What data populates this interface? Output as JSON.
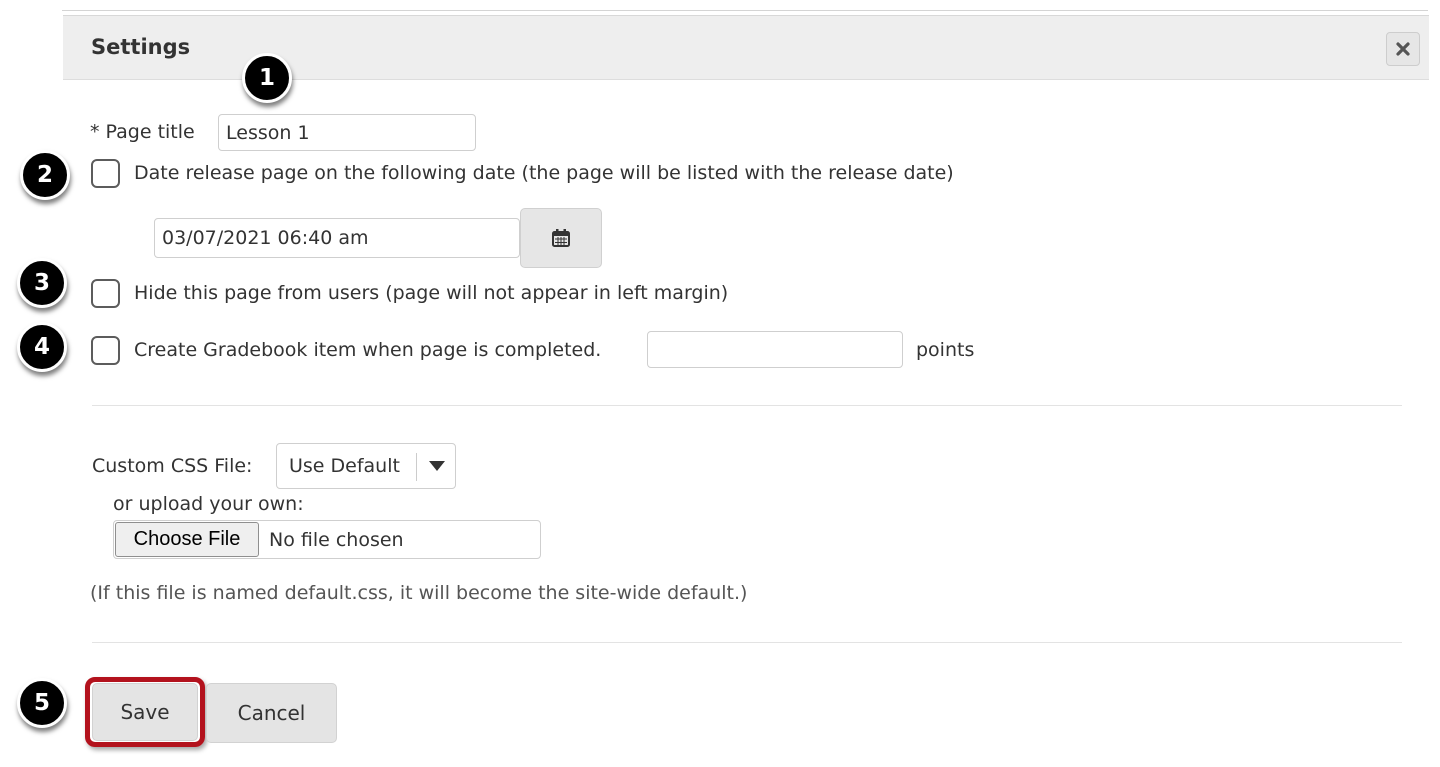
{
  "dialog": {
    "title": "Settings",
    "close_icon": "close-icon"
  },
  "form": {
    "page_title_label": "* Page title",
    "page_title_value": "Lesson 1",
    "date_release_label": "Date release page on the following date (the page will be listed with the release date)",
    "date_release_checked": false,
    "release_date_value": "03/07/2021 06:40 am",
    "calendar_icon": "calendar-icon",
    "hide_page_label": "Hide this page from users (page will not appear in left margin)",
    "hide_page_checked": false,
    "gradebook_label": "Create Gradebook item when page is completed.",
    "gradebook_checked": false,
    "points_value": "",
    "points_label": "points",
    "custom_css_label": "Custom CSS File:",
    "custom_css_selected": "Use Default",
    "upload_label": "or upload your own:",
    "choose_file_label": "Choose File",
    "file_status": "No file chosen",
    "file_note": "(If this file is named default.css, it will become the site-wide default.)"
  },
  "actions": {
    "save_label": "Save",
    "cancel_label": "Cancel",
    "save_highlight_color": "#b3121d"
  },
  "callouts": [
    "1",
    "2",
    "3",
    "4",
    "5"
  ]
}
